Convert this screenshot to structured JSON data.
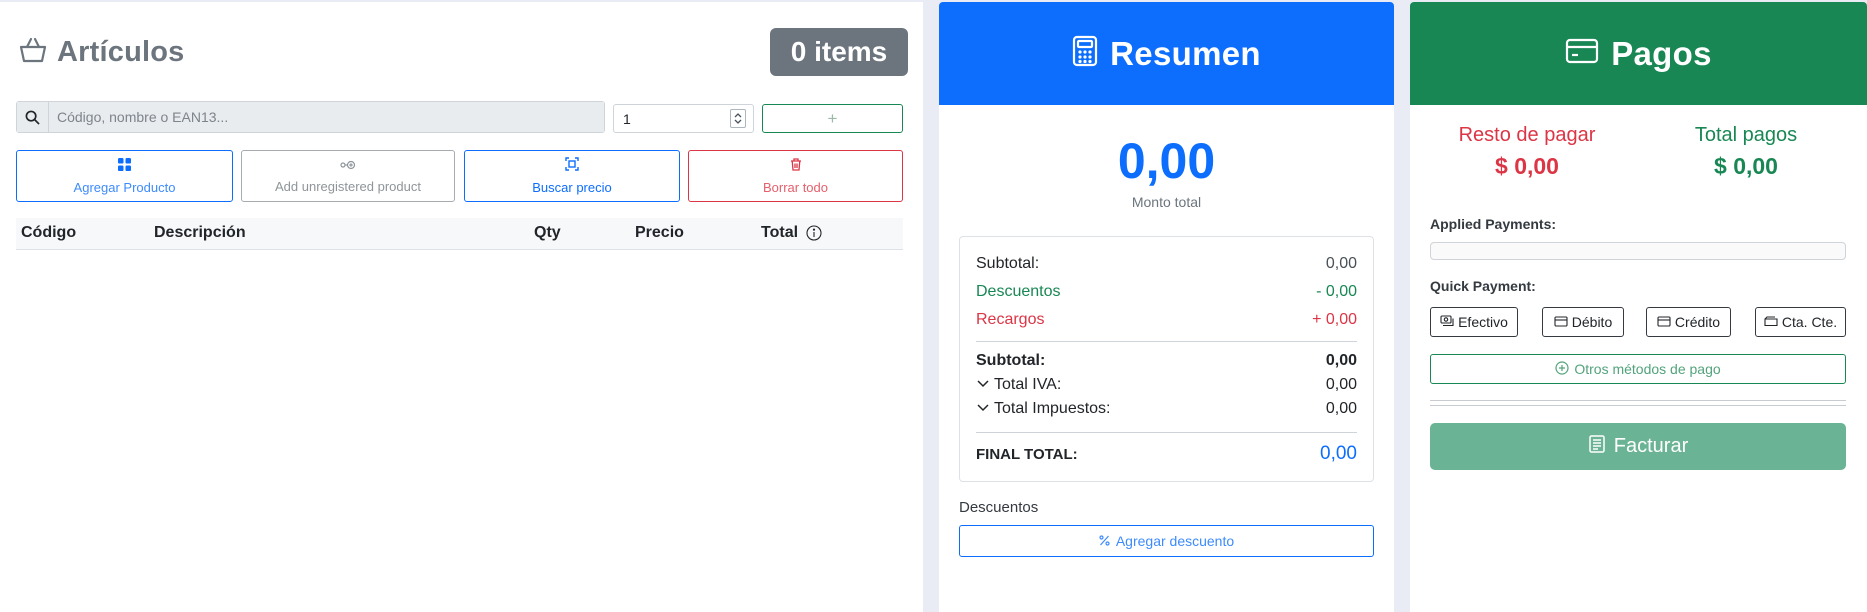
{
  "articulos": {
    "title": "Artículos",
    "items_badge": "0 items",
    "search": {
      "placeholder": "Código, nombre o EAN13..."
    },
    "quantity_value": "1",
    "add_label": "+",
    "actions": [
      {
        "label": "Agregar Producto",
        "icon": "grid-icon"
      },
      {
        "label": "Add unregistered product",
        "icon": "tag-icon"
      },
      {
        "label": "Buscar precio",
        "icon": "scan-icon"
      },
      {
        "label": "Borrar todo",
        "icon": "trash-icon"
      }
    ],
    "columns": [
      "Código",
      "Descripción",
      "Qty",
      "Precio",
      "Total"
    ],
    "rows": []
  },
  "resumen": {
    "title": "Resumen",
    "monto_total": "0,00",
    "monto_label": "Monto total",
    "subtotal_label": "Subtotal:",
    "subtotal_value": "0,00",
    "descuentos_label": "Descuentos",
    "descuentos_value": "- 0,00",
    "recargos_label": "Recargos",
    "recargos_value": "+ 0,00",
    "subtotal2_label": "Subtotal:",
    "subtotal2_value": "0,00",
    "iva_label": "Total IVA:",
    "iva_value": "0,00",
    "impuestos_label": "Total Impuestos:",
    "impuestos_value": "0,00",
    "final_label": "FINAL TOTAL:",
    "final_value": "0,00",
    "descuentos_section": "Descuentos",
    "agregar_descuento": "Agregar descuento"
  },
  "pagos": {
    "title": "Pagos",
    "resto_label": "Resto de pagar",
    "resto_value": "$ 0,00",
    "total_label": "Total pagos",
    "total_value": "$ 0,00",
    "applied_label": "Applied Payments:",
    "quick_label": "Quick Payment:",
    "quick": [
      {
        "label": "Efectivo",
        "icon": "cash-icon"
      },
      {
        "label": "Débito",
        "icon": "card-icon"
      },
      {
        "label": "Crédito",
        "icon": "card-icon"
      },
      {
        "label": "Cta. Cte.",
        "icon": "wallet-icon"
      }
    ],
    "otros_label": "Otros métodos de pago",
    "facturar_label": "Facturar"
  },
  "colors": {
    "primary": "#0d6efd",
    "success": "#198754",
    "danger": "#dc3545",
    "secondary": "#6c757d"
  }
}
